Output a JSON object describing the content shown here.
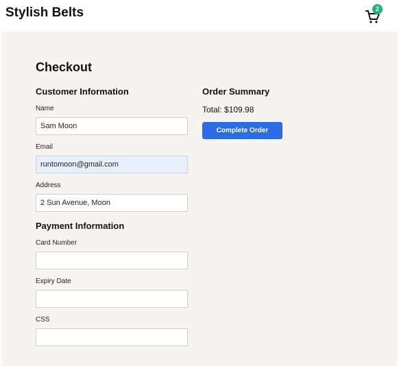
{
  "header": {
    "brand": "Stylish Belts",
    "cart_count": "2",
    "cart_icon": "shopping-cart-icon"
  },
  "checkout": {
    "title": "Checkout",
    "customer": {
      "title": "Customer Information",
      "name_label": "Name",
      "name_value": "Sam Moon",
      "email_label": "Email",
      "email_value": "runtomoon@gmail.com",
      "address_label": "Address",
      "address_value": "2 Sun Avenue, Moon"
    },
    "payment": {
      "title": "Payment Information",
      "card_label": "Card Number",
      "card_value": "",
      "expiry_label": "Expiry Date",
      "expiry_value": "",
      "css_label": "CSS",
      "css_value": ""
    },
    "summary": {
      "title": "Order Summary",
      "total": "Total: $109.98",
      "button_label": "Complete Order"
    }
  },
  "colors": {
    "accent": "#2d6be4",
    "badge": "#22b573",
    "background": "#f5f4f2",
    "autofill": "#e8f0fe"
  }
}
